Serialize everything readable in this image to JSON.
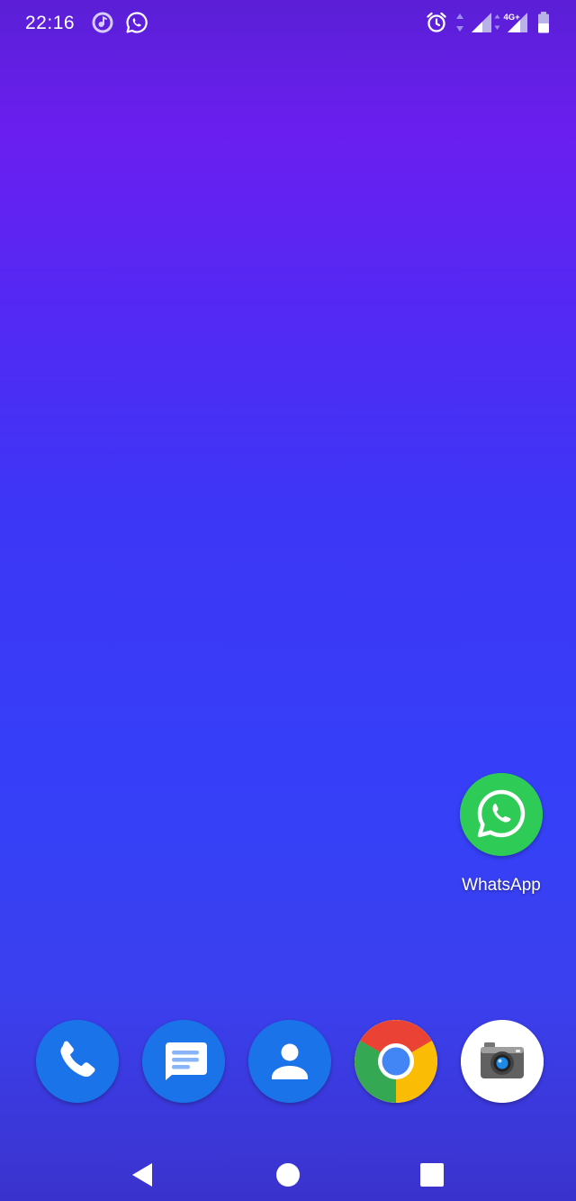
{
  "status_bar": {
    "time": "22:16",
    "network_label": "4G+",
    "left_icons": [
      "music-notification-icon",
      "whatsapp-notification-icon"
    ],
    "right_icons": [
      "alarm-icon",
      "data-arrows-icon",
      "signal-icon",
      "signal-4g-icon",
      "battery-icon"
    ]
  },
  "home": {
    "apps": [
      {
        "id": "whatsapp",
        "label": "WhatsApp",
        "icon": "whatsapp-icon",
        "color": "#25d366"
      }
    ]
  },
  "dock": {
    "apps": [
      {
        "id": "phone",
        "icon": "phone-icon",
        "color": "#1a73e8"
      },
      {
        "id": "messages",
        "icon": "messages-icon",
        "color": "#1a73e8"
      },
      {
        "id": "contacts",
        "icon": "contacts-icon",
        "color": "#1a73e8"
      },
      {
        "id": "chrome",
        "icon": "chrome-icon",
        "color": "#4285f4"
      },
      {
        "id": "camera",
        "icon": "camera-icon",
        "color": "#ffffff"
      }
    ]
  },
  "nav_bar": {
    "buttons": [
      "back-icon",
      "home-icon",
      "recents-icon"
    ]
  },
  "colors": {
    "wallpaper_top": "#5b1fd6",
    "wallpaper_mid": "#3540f7",
    "wallpaper_bottom": "#3a32cc",
    "google_blue": "#1a73e8",
    "whatsapp_green": "#25d366"
  }
}
